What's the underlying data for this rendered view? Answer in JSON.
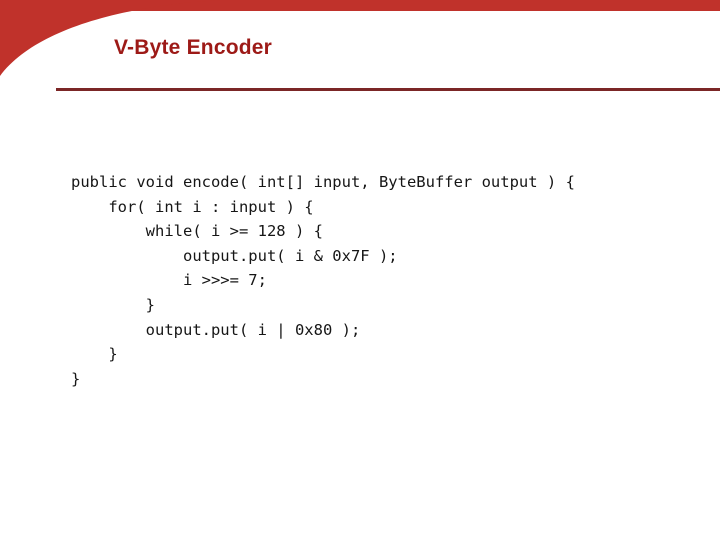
{
  "slide": {
    "title": "V-Byte Encoder",
    "colors": {
      "band_red": "#c0322b",
      "title_red": "#9d1a17",
      "rule_red": "#7b2626",
      "code_text": "#161616",
      "background": "#ffffff"
    }
  },
  "code": {
    "language": "java",
    "lines": [
      "public void encode( int[] input, ByteBuffer output ) {",
      "    for( int i : input ) {",
      "        while( i >= 128 ) {",
      "            output.put( i & 0x7F );",
      "            i >>>= 7;",
      "        }",
      "        output.put( i | 0x80 );",
      "    }",
      "}"
    ]
  }
}
